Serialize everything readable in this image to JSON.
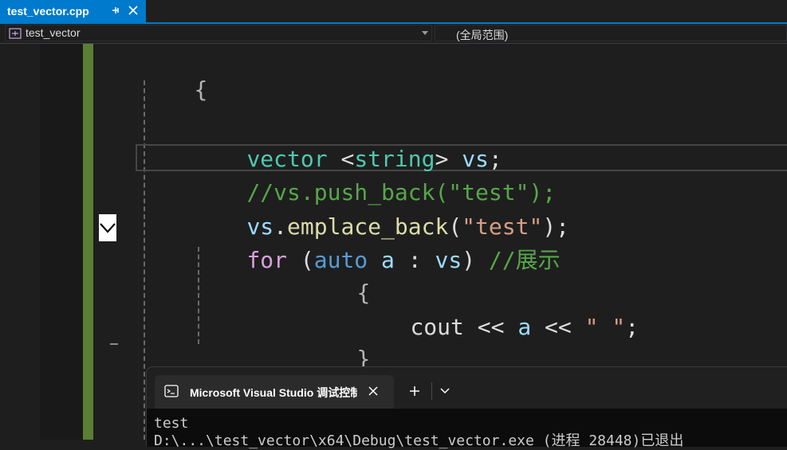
{
  "tab": {
    "title": "test_vector.cpp"
  },
  "navbar": {
    "project": "test_vector",
    "scope": "(全局范围)"
  },
  "code": {
    "line1_brace": "{",
    "line2": {
      "type": "vector",
      "open": " <",
      "arg": "string",
      "close": "> ",
      "var": "vs",
      "semi": ";"
    },
    "line3": {
      "comment": "//vs.push_back(\"test\");"
    },
    "line4": {
      "obj": "vs",
      "dot": ".",
      "fn": "emplace_back",
      "open": "(",
      "str": "\"test\"",
      "close": ");"
    },
    "line5": {
      "kw_for": "for",
      "open": " (",
      "kw_auto": "auto",
      "var": " a",
      "colon": " : ",
      "range": "vs",
      "close": ")",
      "comment": " //展示"
    },
    "line6_brace": "{",
    "line7": {
      "cout": "cout",
      "op1": " << ",
      "var": "a",
      "op2": " << ",
      "str": "\" \"",
      "semi": ";"
    },
    "line8_brace": "}"
  },
  "console": {
    "title": "Microsoft Visual Studio 调试控制台",
    "output_line1": "test",
    "output_line2": "D:\\...\\test_vector\\x64\\Debug\\test_vector.exe (进程 28448)已退出"
  },
  "colors": {
    "accent": "#007acc",
    "change_bar": "#5a7e34",
    "comment": "#57a64a",
    "type": "#4ec9b0",
    "keyword": "#569cd6",
    "control": "#d8a0df",
    "string": "#d69d85"
  },
  "icons": [
    "pin-icon",
    "close-icon",
    "project-icon",
    "dropdown-arrow-icon",
    "fold-collapse-icon",
    "terminal-icon",
    "plus-icon",
    "chevron-down-icon"
  ]
}
